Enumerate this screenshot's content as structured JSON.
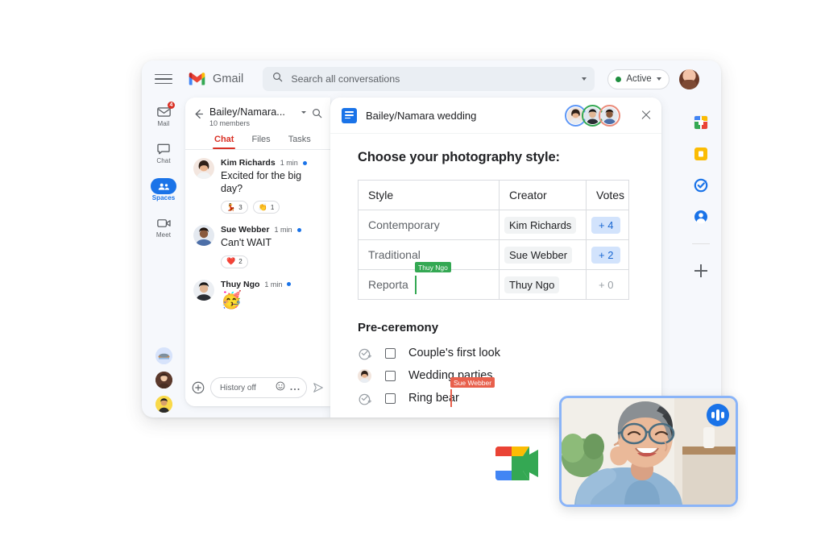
{
  "topbar": {
    "menu_icon": "hamburger-menu-icon",
    "brand": "Gmail",
    "brand_icon": "gmail-logo-icon",
    "search_icon": "search-icon",
    "search_placeholder": "Search all conversations",
    "search_value": "",
    "search_dropdown_icon": "chevron-down-icon",
    "status_label": "Active",
    "status_color": "#1e8e3e",
    "status_dropdown_icon": "chevron-down-icon",
    "account_avatar": "user-avatar"
  },
  "left_rail": {
    "items": [
      {
        "label": "Mail",
        "icon": "mail-icon",
        "badge": "4",
        "selected": false
      },
      {
        "label": "Chat",
        "icon": "chat-icon",
        "badge": "",
        "selected": false
      },
      {
        "label": "Spaces",
        "icon": "spaces-icon",
        "badge": "",
        "selected": true
      },
      {
        "label": "Meet",
        "icon": "meet-icon",
        "badge": "",
        "selected": false
      }
    ],
    "avatars": [
      "avatar-landscape",
      "avatar-person-brown",
      "avatar-person-yellow"
    ],
    "accent_color": "#1a73e8"
  },
  "chat_panel": {
    "back_icon": "back-arrow-icon",
    "title": "Bailey/Namara...",
    "title_dropdown_icon": "chevron-down-icon",
    "members": "10 members",
    "search_icon": "search-icon",
    "tabs": [
      {
        "label": "Chat",
        "active": true
      },
      {
        "label": "Files",
        "active": false
      },
      {
        "label": "Tasks",
        "active": false
      }
    ],
    "active_tab_color": "#d93025",
    "messages": [
      {
        "avatar": "avatar-kim-richards",
        "name": "Kim Richards",
        "time": "1 min",
        "unread": true,
        "text": "Excited for the big day?",
        "emoji": "",
        "reactions": [
          {
            "emoji": "💃",
            "count": "3"
          },
          {
            "emoji": "👏",
            "count": "1"
          }
        ]
      },
      {
        "avatar": "avatar-sue-webber",
        "name": "Sue Webber",
        "time": "1 min",
        "unread": true,
        "text": "Can't WAIT",
        "emoji": "",
        "reactions": [
          {
            "emoji": "❤️",
            "count": "2"
          }
        ]
      },
      {
        "avatar": "avatar-thuy-ngo",
        "name": "Thuy Ngo",
        "time": "1 min",
        "unread": true,
        "text": "",
        "emoji": "🥳",
        "reactions": []
      }
    ],
    "composer": {
      "add_icon": "plus-circle-icon",
      "placeholder": "History off",
      "value": "",
      "emoji_icon": "emoji-icon",
      "more_icon": "more-options-icon",
      "send_icon": "send-icon"
    }
  },
  "doc_panel": {
    "icon": "google-docs-icon",
    "title": "Bailey/Namara wedding",
    "collaborators": [
      "avatar-collaborator-1",
      "avatar-collaborator-2",
      "avatar-collaborator-3"
    ],
    "collaborator_ring_colors": [
      "#5e97f6",
      "#34a853",
      "#ea8b7a"
    ],
    "close_icon": "close-icon",
    "heading": "Choose your photography style:",
    "table": {
      "columns": [
        "Style",
        "Creator",
        "Votes"
      ],
      "rows": [
        {
          "style": "Contemporary",
          "creator": "Kim Richards",
          "votes": "+ 4",
          "votes_zero": false
        },
        {
          "style": "Traditional",
          "creator": "Sue Webber",
          "votes": "+ 2",
          "votes_zero": false
        },
        {
          "style": "Reporta",
          "creator": "Thuy Ngo",
          "votes": "+ 0",
          "votes_zero": true
        }
      ]
    },
    "cursors": [
      {
        "name": "Thuy Ngo",
        "color": "#34a853"
      },
      {
        "name": "Sue Webber",
        "color": "#e8604c"
      }
    ],
    "section_heading": "Pre-ceremony",
    "checklist": [
      {
        "text": "Couple's first look",
        "assign_icon": "add-task-icon",
        "checked": false
      },
      {
        "text": "Wedding parties",
        "assign_icon": "assignee-avatar",
        "checked": false
      },
      {
        "text": "Ring bear",
        "assign_icon": "add-task-icon",
        "checked": false
      }
    ]
  },
  "right_rail": {
    "items": [
      {
        "icon": "google-calendar-icon"
      },
      {
        "icon": "google-keep-icon"
      },
      {
        "icon": "google-tasks-icon"
      },
      {
        "icon": "google-contacts-icon"
      }
    ],
    "add_icon": "add-apps-icon"
  },
  "meet": {
    "logo_icon": "google-meet-logo-icon",
    "video_tile": {
      "participant_image": "video-participant-smiling-woman",
      "mic_indicator_icon": "audio-activity-icon",
      "border_color": "#8ab4f8",
      "mic_color": "#1a73e8"
    }
  }
}
